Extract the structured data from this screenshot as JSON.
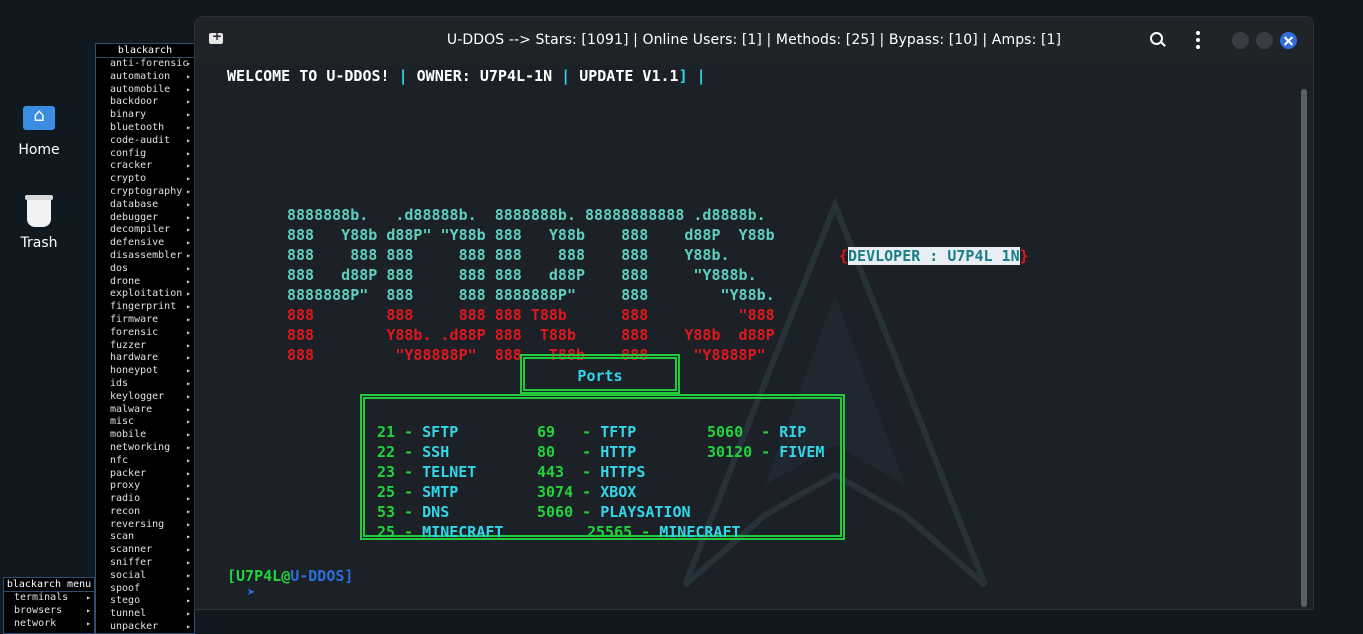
{
  "window": {
    "title": "U-DDOS  --> Stars: [1091] | Online Users: [1] | Methods: [25] | Bypass: [10] | Amps: [1]"
  },
  "desktop": {
    "icons": [
      {
        "label": "Home",
        "icon": "home-folder-icon"
      },
      {
        "label": "Trash",
        "icon": "trash-icon"
      }
    ]
  },
  "blackarch_menu": {
    "title": "blackarch",
    "items": [
      "anti-forensic",
      "automation",
      "automobile",
      "backdoor",
      "binary",
      "bluetooth",
      "code-audit",
      "config",
      "cracker",
      "crypto",
      "cryptography",
      "database",
      "debugger",
      "decompiler",
      "defensive",
      "disassembler",
      "dos",
      "drone",
      "exploitation",
      "fingerprint",
      "firmware",
      "forensic",
      "fuzzer",
      "hardware",
      "honeypot",
      "ids",
      "keylogger",
      "malware",
      "misc",
      "mobile",
      "networking",
      "nfc",
      "packer",
      "proxy",
      "radio",
      "recon",
      "reversing",
      "scan",
      "scanner",
      "sniffer",
      "social",
      "spoof",
      "stego",
      "tunnel",
      "unpacker"
    ]
  },
  "blackarch_menu_root": {
    "title": "blackarch menu",
    "items": [
      "terminals",
      "browsers",
      "network"
    ]
  },
  "terminal": {
    "welcome": "WELCOME TO U-DDOS!",
    "sep1": " | ",
    "owner": "OWNER: U7P4L-1N",
    "sep2": " | ",
    "update": "UPDATE V1.1",
    "tail": "] |",
    "ascii_cyan": [
      "8888888b.   .d88888b.  8888888b. 88888888888 .d8888b.",
      "888   Y88b d88P\" \"Y88b 888   Y88b    888    d88P  Y88b",
      "888    888 888     888 888    888    888    Y88b.",
      "888   d88P 888     888 888   d88P    888     \"Y888b.",
      "8888888P\"  888     888 8888888P\"     888        \"Y88b."
    ],
    "ascii_red": [
      "888        888     888 888 T88b      888          \"888",
      "888        Y88b. .d88P 888  T88b     888    Y88b  d88P",
      "888         \"Y88888P\"  888   T88b    888     \"Y8888P\""
    ],
    "dev_open": "{",
    "developer": "DEVLOPER : U7P4L 1N",
    "dev_close": "}",
    "ports_title": "Ports",
    "ports": [
      {
        "num": "21 - ",
        "name": "SFTP"
      },
      {
        "num": "22 - ",
        "name": "SSH"
      },
      {
        "num": "23 - ",
        "name": "TELNET"
      },
      {
        "num": "25 - ",
        "name": "SMTP"
      },
      {
        "num": "53 - ",
        "name": "DNS"
      },
      {
        "num": "25 - ",
        "name": "MINECRAFT"
      },
      {
        "num": "69   - ",
        "name": "TFTP"
      },
      {
        "num": "80   - ",
        "name": "HTTP"
      },
      {
        "num": "443  - ",
        "name": "HTTPS"
      },
      {
        "num": "3074 - ",
        "name": "XBOX"
      },
      {
        "num": "5060 - ",
        "name": "PLAYSATION"
      },
      {
        "num": "25565 - ",
        "name": "MINECRAFT"
      },
      {
        "num": "5060  - ",
        "name": "RIP"
      },
      {
        "num": "30120 - ",
        "name": "FIVEM"
      }
    ],
    "prompt_open": "[",
    "prompt_user": "U7P4L",
    "prompt_at": "@",
    "prompt_host": "U-DDOS",
    "prompt_close": "]",
    "prompt_arrow": "➤"
  },
  "colors": {
    "cyan": "#33d6e8",
    "green": "#22d43a",
    "red": "#e0181e",
    "blue": "#2a6fd8",
    "terminal_bg": "#1b2127"
  }
}
